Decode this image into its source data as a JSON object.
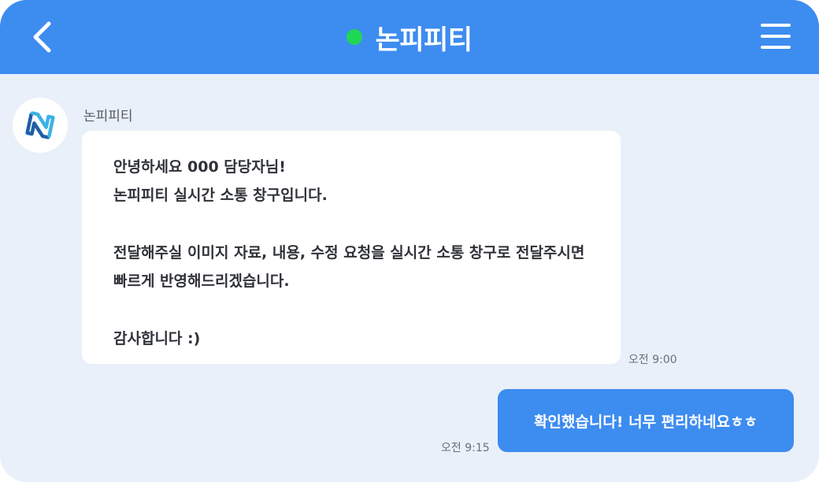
{
  "header": {
    "title": "논피피티",
    "status": "online",
    "back_icon": "chevron-left-icon",
    "menu_icon": "hamburger-menu-icon",
    "status_color": "#1fd655"
  },
  "colors": {
    "accent": "#3d8cf0",
    "background": "#e9f0f9",
    "bubble_incoming": "#ffffff",
    "bubble_outgoing": "#3d8cf0"
  },
  "messages": [
    {
      "direction": "incoming",
      "sender": "논피피티",
      "avatar_icon": "nonppt-logo-icon",
      "lines": [
        "안녕하세요 000 담당자님!",
        "논피피티 실시간 소통 창구입니다.",
        "",
        "전달해주실 이미지 자료, 내용, 수정 요청을 실시간 소통 창구로 전달주시면",
        "빠르게 반영해드리겠습니다.",
        "",
        "감사합니다 :)"
      ],
      "time": "오전 9:00"
    },
    {
      "direction": "outgoing",
      "text": "확인했습니다!  너무 편리하네요ㅎㅎ",
      "time": "오전 9:15"
    }
  ]
}
